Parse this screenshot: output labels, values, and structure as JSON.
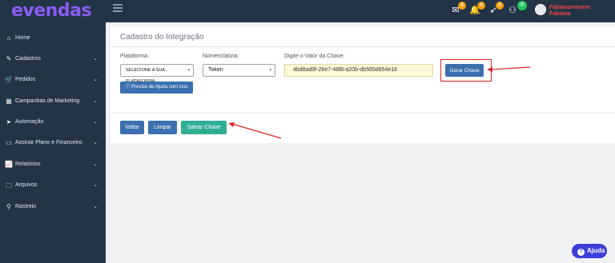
{
  "brand": {
    "logo": "evendas"
  },
  "topbar": {
    "badges": [
      "0",
      "0",
      "0"
    ],
    "user_name": "Fabianamovem Fabiana"
  },
  "sidebar": {
    "items": [
      {
        "label": "Home",
        "icon": "home-icon",
        "glyph": "⌂",
        "has_chevron": false
      },
      {
        "label": "Cadastros",
        "icon": "edit-icon",
        "glyph": "✎",
        "has_chevron": true
      },
      {
        "label": "Pedidos",
        "icon": "cart-icon",
        "glyph": "🛒",
        "has_chevron": true
      },
      {
        "label": "Campanhas de Marketing",
        "icon": "campaign-icon",
        "glyph": "▦",
        "has_chevron": true
      },
      {
        "label": "Automação",
        "icon": "bolt-icon",
        "glyph": "➤",
        "has_chevron": true
      },
      {
        "label": "Assinar Plano e Financeiro",
        "icon": "card-icon",
        "glyph": "▭",
        "has_chevron": true
      },
      {
        "label": "Relatórios",
        "icon": "chart-icon",
        "glyph": "📈",
        "has_chevron": true
      },
      {
        "label": "Arquivos",
        "icon": "folder-icon",
        "glyph": "🗀",
        "has_chevron": true
      },
      {
        "label": "Rastreio",
        "icon": "search-icon",
        "glyph": "⚲",
        "has_chevron": true
      }
    ]
  },
  "form": {
    "title": "Cadastro do Integração",
    "plataforma_label": "Plataforma:",
    "plataforma_value": "SELECIONE A SUA PLATAFORMA",
    "nomenclatura_label": "Nomenclatura:",
    "nomenclatura_value": "Token",
    "chave_label": "Digite o Valor da Chave:",
    "chave_value": "4bd8ad9f-26e7-48f8-a20b-db565d854e16",
    "gerar_label": "Gerar Chave",
    "ajuda_label": "Preciso de Ajuda com isso",
    "voltar_label": "Voltar",
    "limpar_label": "Limpar",
    "salvar_label": "Salvar Chave"
  },
  "help_widget": {
    "label": "Ajuda"
  },
  "colors": {
    "sidebar": "#243447",
    "primary": "#3b6fb0",
    "success": "#2fae94",
    "highlight": "#dc2626",
    "brand": "#8b5cf6"
  }
}
